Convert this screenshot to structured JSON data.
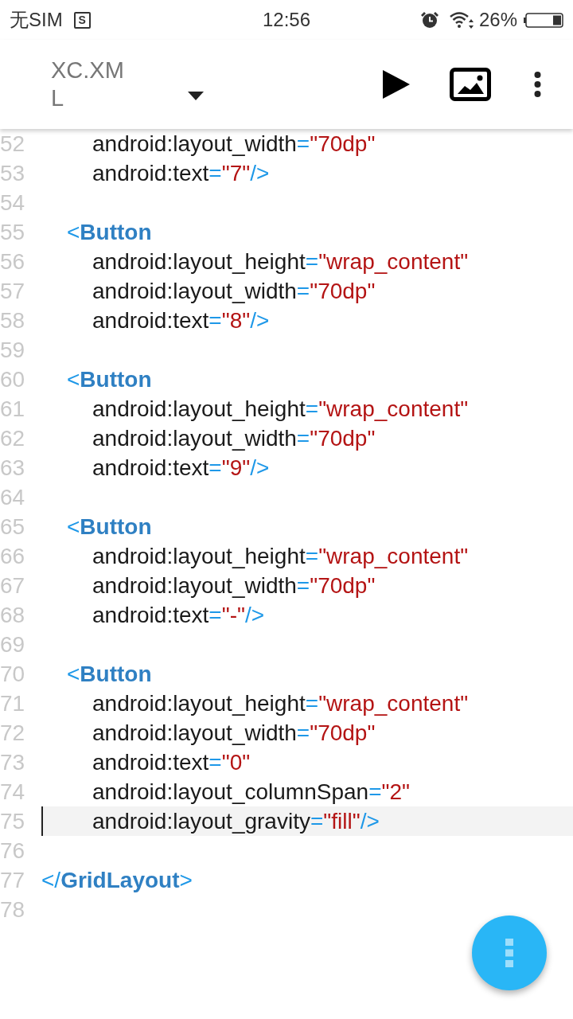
{
  "status_bar": {
    "carrier": "无SIM",
    "sim_badge": "S",
    "time": "12:56",
    "battery": "26%"
  },
  "toolbar": {
    "title": "XC.XML"
  },
  "editor": {
    "lines": [
      {
        "number": "52",
        "selected": false,
        "kind": "attribute",
        "tokens": [
          {
            "kind": "attr",
            "text": "android:layout_width"
          },
          {
            "kind": "punct",
            "text": "="
          },
          {
            "kind": "string",
            "text": "\"70dp\""
          }
        ]
      },
      {
        "number": "53",
        "selected": false,
        "kind": "attribute",
        "tokens": [
          {
            "kind": "attr",
            "text": "android:text"
          },
          {
            "kind": "punct",
            "text": "="
          },
          {
            "kind": "string",
            "text": "\"7\""
          },
          {
            "kind": "punct",
            "text": "/>"
          }
        ]
      },
      {
        "number": "54",
        "selected": false
      },
      {
        "number": "55",
        "selected": false,
        "kind": "element",
        "tokens": [
          {
            "kind": "punct",
            "text": "<"
          },
          {
            "kind": "tag",
            "text": "Button"
          }
        ]
      },
      {
        "number": "56",
        "selected": false,
        "kind": "attribute",
        "tokens": [
          {
            "kind": "attr",
            "text": "android:layout_height"
          },
          {
            "kind": "punct",
            "text": "="
          },
          {
            "kind": "string",
            "text": "\"wrap_content\""
          }
        ]
      },
      {
        "number": "57",
        "selected": false,
        "kind": "attribute",
        "tokens": [
          {
            "kind": "attr",
            "text": "android:layout_width"
          },
          {
            "kind": "punct",
            "text": "="
          },
          {
            "kind": "string",
            "text": "\"70dp\""
          }
        ]
      },
      {
        "number": "58",
        "selected": false,
        "kind": "attribute",
        "tokens": [
          {
            "kind": "attr",
            "text": "android:text"
          },
          {
            "kind": "punct",
            "text": "="
          },
          {
            "kind": "string",
            "text": "\"8\""
          },
          {
            "kind": "punct",
            "text": "/>"
          }
        ]
      },
      {
        "number": "59",
        "selected": false
      },
      {
        "number": "60",
        "selected": false,
        "kind": "element",
        "tokens": [
          {
            "kind": "punct",
            "text": "<"
          },
          {
            "kind": "tag",
            "text": "Button"
          }
        ]
      },
      {
        "number": "61",
        "selected": false,
        "kind": "attribute",
        "tokens": [
          {
            "kind": "attr",
            "text": "android:layout_height"
          },
          {
            "kind": "punct",
            "text": "="
          },
          {
            "kind": "string",
            "text": "\"wrap_content\""
          }
        ]
      },
      {
        "number": "62",
        "selected": false,
        "kind": "attribute",
        "tokens": [
          {
            "kind": "attr",
            "text": "android:layout_width"
          },
          {
            "kind": "punct",
            "text": "="
          },
          {
            "kind": "string",
            "text": "\"70dp\""
          }
        ]
      },
      {
        "number": "63",
        "selected": false,
        "kind": "attribute",
        "tokens": [
          {
            "kind": "attr",
            "text": "android:text"
          },
          {
            "kind": "punct",
            "text": "="
          },
          {
            "kind": "string",
            "text": "\"9\""
          },
          {
            "kind": "punct",
            "text": "/>"
          }
        ]
      },
      {
        "number": "64",
        "selected": false
      },
      {
        "number": "65",
        "selected": false,
        "kind": "element",
        "tokens": [
          {
            "kind": "punct",
            "text": "<"
          },
          {
            "kind": "tag",
            "text": "Button"
          }
        ]
      },
      {
        "number": "66",
        "selected": false,
        "kind": "attribute",
        "tokens": [
          {
            "kind": "attr",
            "text": "android:layout_height"
          },
          {
            "kind": "punct",
            "text": "="
          },
          {
            "kind": "string",
            "text": "\"wrap_content\""
          }
        ]
      },
      {
        "number": "67",
        "selected": false,
        "kind": "attribute",
        "tokens": [
          {
            "kind": "attr",
            "text": "android:layout_width"
          },
          {
            "kind": "punct",
            "text": "="
          },
          {
            "kind": "string",
            "text": "\"70dp\""
          }
        ]
      },
      {
        "number": "68",
        "selected": false,
        "kind": "attribute",
        "tokens": [
          {
            "kind": "attr",
            "text": "android:text"
          },
          {
            "kind": "punct",
            "text": "="
          },
          {
            "kind": "string",
            "text": "\"-\""
          },
          {
            "kind": "punct",
            "text": "/>"
          }
        ]
      },
      {
        "number": "69",
        "selected": false
      },
      {
        "number": "70",
        "selected": false,
        "kind": "element",
        "tokens": [
          {
            "kind": "punct",
            "text": "<"
          },
          {
            "kind": "tag",
            "text": "Button"
          }
        ]
      },
      {
        "number": "71",
        "selected": false,
        "kind": "attribute",
        "tokens": [
          {
            "kind": "attr",
            "text": "android:layout_height"
          },
          {
            "kind": "punct",
            "text": "="
          },
          {
            "kind": "string",
            "text": "\"wrap_content\""
          }
        ]
      },
      {
        "number": "72",
        "selected": false,
        "kind": "attribute",
        "tokens": [
          {
            "kind": "attr",
            "text": "android:layout_width"
          },
          {
            "kind": "punct",
            "text": "="
          },
          {
            "kind": "string",
            "text": "\"70dp\""
          }
        ]
      },
      {
        "number": "73",
        "selected": false,
        "kind": "attribute",
        "tokens": [
          {
            "kind": "attr",
            "text": "android:text"
          },
          {
            "kind": "punct",
            "text": "="
          },
          {
            "kind": "string",
            "text": "\"0\""
          }
        ]
      },
      {
        "number": "74",
        "selected": false,
        "kind": "attribute",
        "tokens": [
          {
            "kind": "attr",
            "text": "android:layout_columnSpan"
          },
          {
            "kind": "punct",
            "text": "="
          },
          {
            "kind": "string",
            "text": "\"2\""
          }
        ]
      },
      {
        "number": "75",
        "selected": true,
        "kind": "attribute",
        "tokens": [
          {
            "kind": "attr",
            "text": "android:layout_gravity"
          },
          {
            "kind": "punct",
            "text": "="
          },
          {
            "kind": "string",
            "text": "\"fill\""
          },
          {
            "kind": "punct",
            "text": "/>"
          }
        ]
      },
      {
        "number": "76",
        "selected": false
      },
      {
        "number": "77",
        "selected": false,
        "kind": "root",
        "tokens": [
          {
            "kind": "punct",
            "text": "</"
          },
          {
            "kind": "tag",
            "text": "GridLayout"
          },
          {
            "kind": "punct",
            "text": ">"
          }
        ]
      },
      {
        "number": "78",
        "selected": false
      }
    ]
  }
}
